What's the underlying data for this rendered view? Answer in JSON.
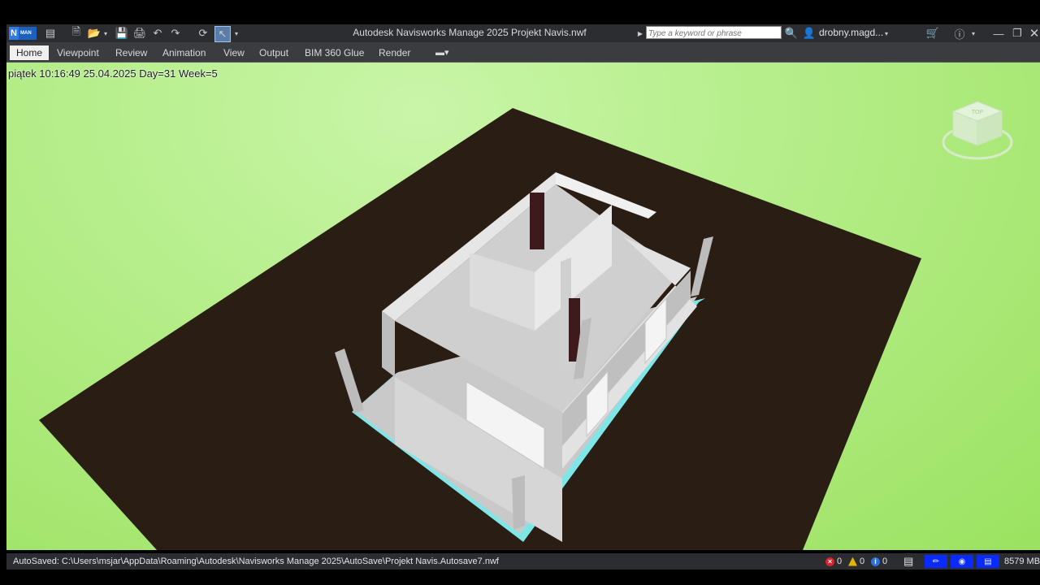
{
  "app": {
    "logo_letter": "N",
    "logo_sub": "MAN",
    "title": "Autodesk Navisworks Manage 2025   Projekt Navis.nwf",
    "search_placeholder": "Type a keyword or phrase",
    "user": "drobny.magd..."
  },
  "ribbon": {
    "tabs": [
      {
        "label": "Home",
        "active": true
      },
      {
        "label": "Viewpoint"
      },
      {
        "label": "Review"
      },
      {
        "label": "Animation"
      },
      {
        "label": "View"
      },
      {
        "label": "Output"
      },
      {
        "label": "BIM 360 Glue"
      },
      {
        "label": "Render"
      }
    ]
  },
  "viewport": {
    "clock": "piątek 10:16:49 25.04.2025 Day=31 Week=5",
    "viewcube_label": "TOP",
    "colors": {
      "ground": "#2a1e14",
      "walls": "#d9d9d9",
      "slab_edge": "#7fe6e8",
      "columns_dark": "#3d1a1c"
    }
  },
  "statusbar": {
    "autosave": "AutoSaved: C:\\Users\\msjar\\AppData\\Roaming\\Autodesk\\Navisworks Manage 2025\\AutoSave\\Projekt Navis.Autosave7.nwf",
    "errors": "0",
    "warnings": "0",
    "info": "0",
    "memory": "8579 MB"
  }
}
